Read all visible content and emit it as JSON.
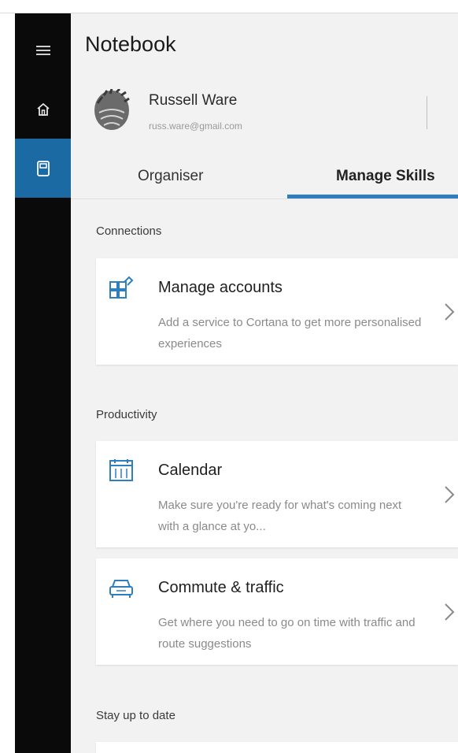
{
  "app": {
    "title": "Notebook"
  },
  "rail": {
    "items": [
      {
        "name": "hamburger-icon"
      },
      {
        "name": "home-icon"
      },
      {
        "name": "notebook-icon",
        "active": true
      }
    ]
  },
  "user": {
    "name": "Russell Ware",
    "email": "russ.ware@gmail.com"
  },
  "tabs": [
    {
      "label": "Organiser",
      "active": false
    },
    {
      "label": "Manage Skills",
      "active": true
    }
  ],
  "sections": {
    "connections": {
      "label": "Connections",
      "cards": [
        {
          "title": "Manage accounts",
          "desc": "Add a service to Cortana to get more personalised experiences",
          "icon": "manage-accounts-icon"
        }
      ]
    },
    "productivity": {
      "label": "Productivity",
      "cards": [
        {
          "title": "Calendar",
          "desc": "Make sure you're ready for what's coming next with a glance at yo...",
          "icon": "calendar-icon"
        },
        {
          "title": "Commute & traffic",
          "desc": "Get where you need to go on time with traffic and route suggestions",
          "icon": "car-icon"
        }
      ]
    },
    "stay_up_to_date": {
      "label": "Stay up to date"
    }
  },
  "colors": {
    "accent": "#2f7fbf",
    "rail": "#0a0a0a",
    "rail_active": "#1b6aa3",
    "panel": "#f2f2f2"
  }
}
